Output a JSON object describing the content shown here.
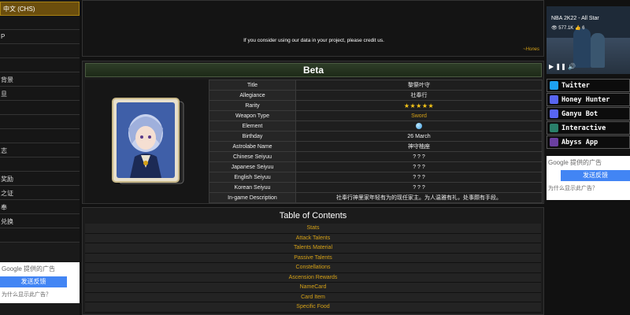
{
  "left_sidebar": {
    "language": "中文 (CHS)",
    "items": [
      "",
      "",
      "",
      "",
      "",
      "",
      "",
      "",
      "",
      "",
      "",
      "",
      "",
      "",
      "",
      ""
    ],
    "item_fragments": [
      "",
      "P",
      "",
      "",
      "背景",
      "旦",
      "",
      "",
      "",
      "志",
      "",
      "奖励",
      "之证",
      "奉",
      "兑换",
      ""
    ],
    "ad": {
      "provider": "Google 提供的广告",
      "feedback": "发送反馈",
      "why": "为什么显示此广告？"
    }
  },
  "credit": {
    "text": "If you consider using our data in your project, please credit us.",
    "signature": "~Hones"
  },
  "character": {
    "name": "Beta",
    "fields": [
      {
        "key": "Title",
        "value": "黎祭叶守"
      },
      {
        "key": "Allegiance",
        "value": "社奉行"
      },
      {
        "key": "Rarity",
        "value": "★★★★★"
      },
      {
        "key": "Weapon Type",
        "value": "Sword"
      },
      {
        "key": "Element",
        "value": ""
      },
      {
        "key": "Birthday",
        "value": "26 March"
      },
      {
        "key": "Astrolabe Name",
        "value": "神守柚座"
      },
      {
        "key": "Chinese Seiyuu",
        "value": "? ? ?"
      },
      {
        "key": "Japanese Seiyuu",
        "value": "? ? ?"
      },
      {
        "key": "English Seiyuu",
        "value": "? ? ?"
      },
      {
        "key": "Korean Seiyuu",
        "value": "? ? ?"
      },
      {
        "key": "In-game Description",
        "value": "社奉行神里家年轻有为的现任家主。为人温雅有礼，处事颇有手段。"
      }
    ],
    "element_color": "#3a9be0"
  },
  "toc": {
    "title": "Table of Contents",
    "items": [
      "Stats",
      "Attack Talents",
      "Talents Material",
      "Passive Talents",
      "Constellations",
      "Ascension Rewards",
      "NameCard",
      "Card Item",
      "Specific Food"
    ]
  },
  "video": {
    "title": "NBA 2K22 - All Star",
    "views": "577.1K",
    "likes": "6"
  },
  "links": [
    {
      "label": "Twitter",
      "icon": "twitter-icon",
      "color": "#1da1f2"
    },
    {
      "label": "Honey Hunter",
      "icon": "discord-icon",
      "color": "#5865f2"
    },
    {
      "label": "Ganyu Bot",
      "icon": "discord-icon",
      "color": "#5865f2"
    },
    {
      "label": "Interactive",
      "icon": "genshin-icon",
      "color": "#2a7f6a"
    },
    {
      "label": "Abyss App",
      "icon": "abyss-icon",
      "color": "#6a3fa0"
    }
  ],
  "right_ad": {
    "provider": "Google 提供的广告",
    "feedback": "发送反馈",
    "why": "为什么显示此广告？"
  },
  "colors": {
    "accent": "#d4a017",
    "link_bg": "#0c0c0c",
    "header_bar": "#2e3d28"
  }
}
